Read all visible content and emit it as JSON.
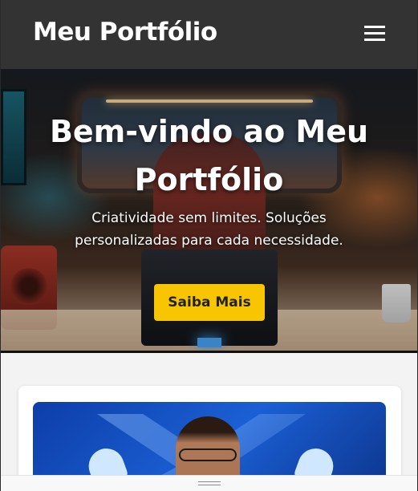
{
  "header": {
    "site_title": "Meu Portfólio",
    "menu_icon": "hamburger-menu-icon"
  },
  "hero": {
    "title": "Bem-vindo ao Meu Portfólio",
    "subtitle": "Criatividade sem limites. Soluções personalizadas para cada necessidade.",
    "cta_label": "Saiba Mais",
    "background_image": "futuristic-workspace-illustration"
  },
  "card": {
    "image": "portrait-with-blue-background-illustration"
  },
  "bottom_bar": {
    "handle_icon": "drag-handle-icon"
  },
  "colors": {
    "header_bg": "#333333",
    "cta_bg": "#f7c600",
    "page_bg": "#f3f3f3"
  }
}
